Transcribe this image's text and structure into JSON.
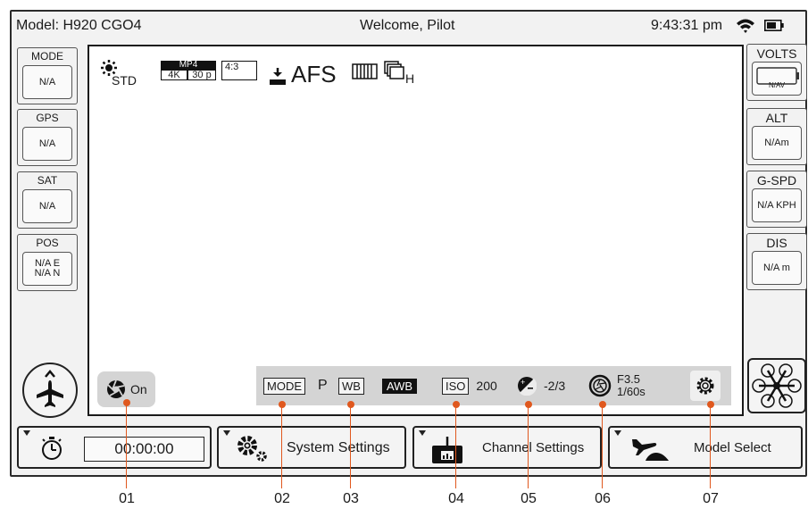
{
  "header": {
    "model": "Model: H920 CGO4",
    "welcome": "Welcome, Pilot",
    "time": "9:43:31 pm",
    "wifi_icon": "wifi-icon",
    "battery_icon": "battery-icon"
  },
  "left_panel": [
    {
      "label": "MODE",
      "value": "N/A"
    },
    {
      "label": "GPS",
      "value": "N/A"
    },
    {
      "label": "SAT",
      "value": "N/A"
    },
    {
      "label": "POS",
      "value_line1": "N/A E",
      "value_line2": "N/A N"
    }
  ],
  "right_panel": [
    {
      "label": "VOLTS",
      "value": "N/AV"
    },
    {
      "label": "ALT",
      "value": "N/Am"
    },
    {
      "label": "G-SPD",
      "value": "N/A KPH"
    },
    {
      "label": "DIS",
      "value": "N/A m"
    }
  ],
  "hud": {
    "wb_mode": "STD",
    "format": "MP4",
    "resolution": "4K",
    "fps": "30 p",
    "aspect": "4:3",
    "focus": "AFS",
    "burst_suffix": "H"
  },
  "shutter": {
    "state": "On"
  },
  "camera_row": {
    "mode_label": "MODE",
    "mode_value": "P",
    "wb_label": "WB",
    "wb_value": "AWB",
    "iso_label": "ISO",
    "iso_value": "200",
    "ev_value": "-2/3",
    "aperture": "F3.5",
    "shutter_speed": "1/60s"
  },
  "bottom_bar": {
    "timer": "00:00:00",
    "system_settings": "System Settings",
    "channel_settings": "Channel Settings",
    "model_select": "Model Select"
  },
  "callouts": [
    "01",
    "02",
    "03",
    "04",
    "05",
    "06",
    "07"
  ],
  "colors": {
    "callout": "#e0581e",
    "panel_bg": "#f2f2f2",
    "bar_bg": "#d4d4d4"
  }
}
